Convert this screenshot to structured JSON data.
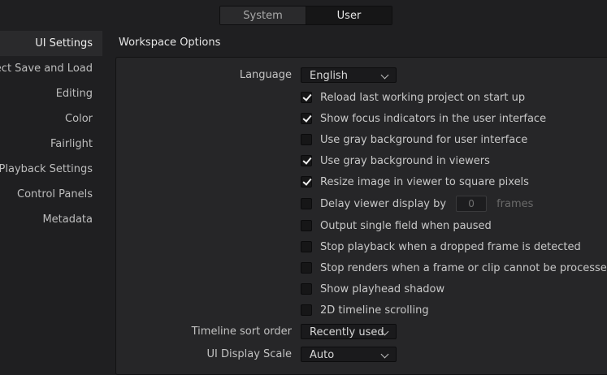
{
  "tabs": {
    "system": "System",
    "user": "User"
  },
  "sidebar": {
    "items": [
      {
        "label": "UI Settings"
      },
      {
        "label": "oject Save and Load"
      },
      {
        "label": "Editing"
      },
      {
        "label": "Color"
      },
      {
        "label": "Fairlight"
      },
      {
        "label": "Playback Settings"
      },
      {
        "label": "Control Panels"
      },
      {
        "label": "Metadata"
      }
    ]
  },
  "workspace": {
    "title": "Workspace Options",
    "language_label": "Language",
    "language_value": "English",
    "checkboxes": [
      {
        "label": "Reload last working project on start up",
        "checked": true
      },
      {
        "label": "Show focus indicators in the user interface",
        "checked": true
      },
      {
        "label": "Use gray background for user interface",
        "checked": false
      },
      {
        "label": "Use gray background in viewers",
        "checked": true
      },
      {
        "label": "Resize image in viewer to square pixels",
        "checked": true
      },
      {
        "label": "Delay viewer display by",
        "checked": false,
        "input_value": "0",
        "suffix": "frames"
      },
      {
        "label": "Output single field when paused",
        "checked": false
      },
      {
        "label": "Stop playback when a dropped frame is detected",
        "checked": false
      },
      {
        "label": "Stop renders when a frame or clip cannot be processed",
        "checked": false
      },
      {
        "label": "Show playhead shadow",
        "checked": false
      },
      {
        "label": "2D timeline scrolling",
        "checked": false
      }
    ],
    "sort_label": "Timeline sort order",
    "sort_value": "Recently used",
    "scale_label": "UI Display Scale",
    "scale_value": "Auto"
  }
}
